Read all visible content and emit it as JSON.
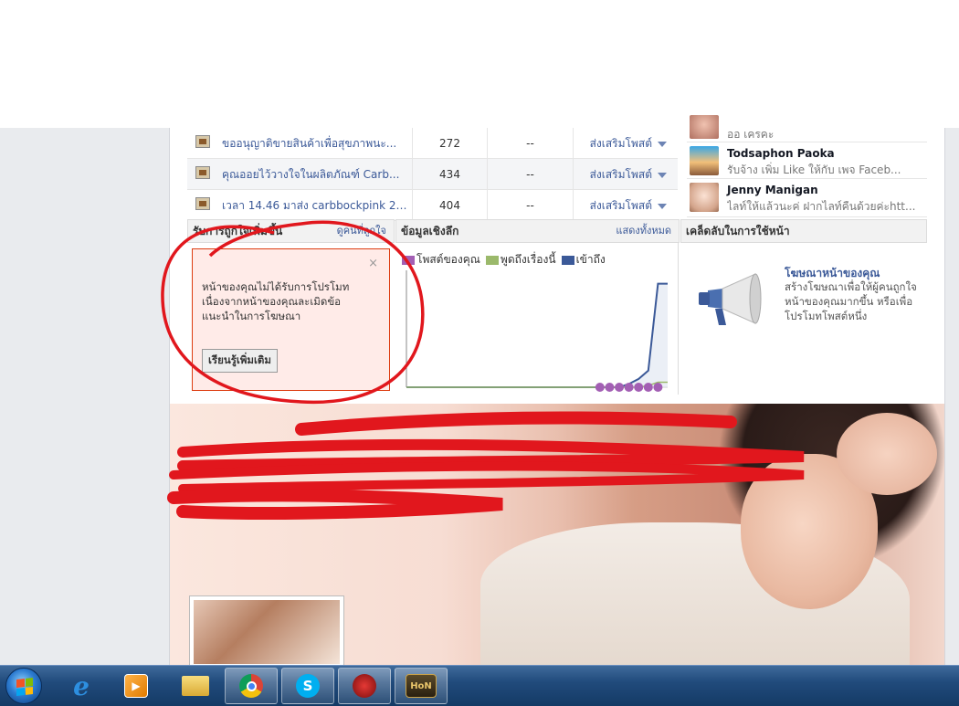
{
  "posts": [
    {
      "title": "ขออนุญาติขายสินค้าเพื่อสุขภาพนะ...",
      "reach": "272",
      "talking": "--",
      "boost": "ส่งเสริมโพสต์"
    },
    {
      "title": "คุณออยไว้วางใจในผลิตภัณฑ์ Carb...",
      "reach": "434",
      "talking": "--",
      "boost": "ส่งเสริมโพสต์"
    },
    {
      "title": "เวลา 14.46 มาส่ง carbbockpink 2 ...",
      "reach": "404",
      "talking": "--",
      "boost": "ส่งเสริมโพสต์"
    }
  ],
  "people": [
    {
      "name": "",
      "text": "ออ เครคะ"
    },
    {
      "name": "Todsaphon Paoka",
      "text": "รับจ้าง เพิ่ม Like ให้กับ เพจ Faceb..."
    },
    {
      "name": "Jenny Manigan",
      "text": "ไลท์ให้แล้วนะค่ ฝากไลท์คืนด้วยค่ะhtt..."
    }
  ],
  "sections": {
    "likes": {
      "title": "รับการถูกใจเพิ่มขึ้น",
      "link": "ดูคนที่ถูกใจ"
    },
    "insights": {
      "title": "ข้อมูลเชิงลึก",
      "link": "แสดงทั้งหมด"
    },
    "tips": {
      "title": "เคล็ดลับในการใช้หน้า"
    }
  },
  "promo": {
    "close": "×",
    "message": "หน้าของคุณไม่ได้รับการโปรโมท เนื่องจากหน้าของคุณละเมิดข้อแนะนำในการโฆษณา",
    "button": "เรียนรู้เพิ่มเติม"
  },
  "tips": {
    "title": "โฆษณาหน้าของคุณ",
    "text": "สร้างโฆษณาเพื่อให้ผู้คนถูกใจหน้าของคุณมากขึ้น หรือเพื่อโปรโมทโพสต์หนึ่ง"
  },
  "chart_data": {
    "type": "line",
    "title": "",
    "xlabel": "",
    "ylabel": "",
    "legend": [
      "โพสต์ของคุณ",
      "พูดถึงเรื่องนี้",
      "เข้าถึง"
    ],
    "colors": {
      "posts": "#a35fb4",
      "talking": "#9bb96b",
      "reach": "#3b5998"
    },
    "x": [
      1,
      2,
      3,
      4,
      5,
      6,
      7,
      8,
      9,
      10,
      11,
      12,
      13,
      14,
      15,
      16,
      17,
      18,
      19,
      20,
      21,
      22,
      23,
      24,
      25,
      26,
      27,
      28
    ],
    "series": [
      {
        "name": "เข้าถึง",
        "values": [
          0,
          0,
          0,
          0,
          0,
          0,
          0,
          0,
          0,
          0,
          0,
          0,
          0,
          0,
          0,
          0,
          0,
          0,
          0,
          0,
          0,
          0,
          0,
          2,
          5,
          10,
          62,
          62
        ]
      },
      {
        "name": "พูดถึงเรื่องนี้",
        "values": [
          0,
          0,
          0,
          0,
          0,
          0,
          0,
          0,
          0,
          0,
          0,
          0,
          0,
          0,
          0,
          0,
          0,
          0,
          0,
          0,
          0,
          0,
          0,
          0,
          0,
          1,
          3,
          3
        ]
      }
    ],
    "post_markers": [
      20,
      21,
      22,
      23,
      24,
      25,
      26
    ],
    "ylim": [
      0,
      70
    ]
  },
  "taskbar": {
    "apps": [
      "start",
      "internet-explorer",
      "media-player",
      "file-explorer",
      "chrome",
      "skype",
      "game-app",
      "hon"
    ]
  }
}
